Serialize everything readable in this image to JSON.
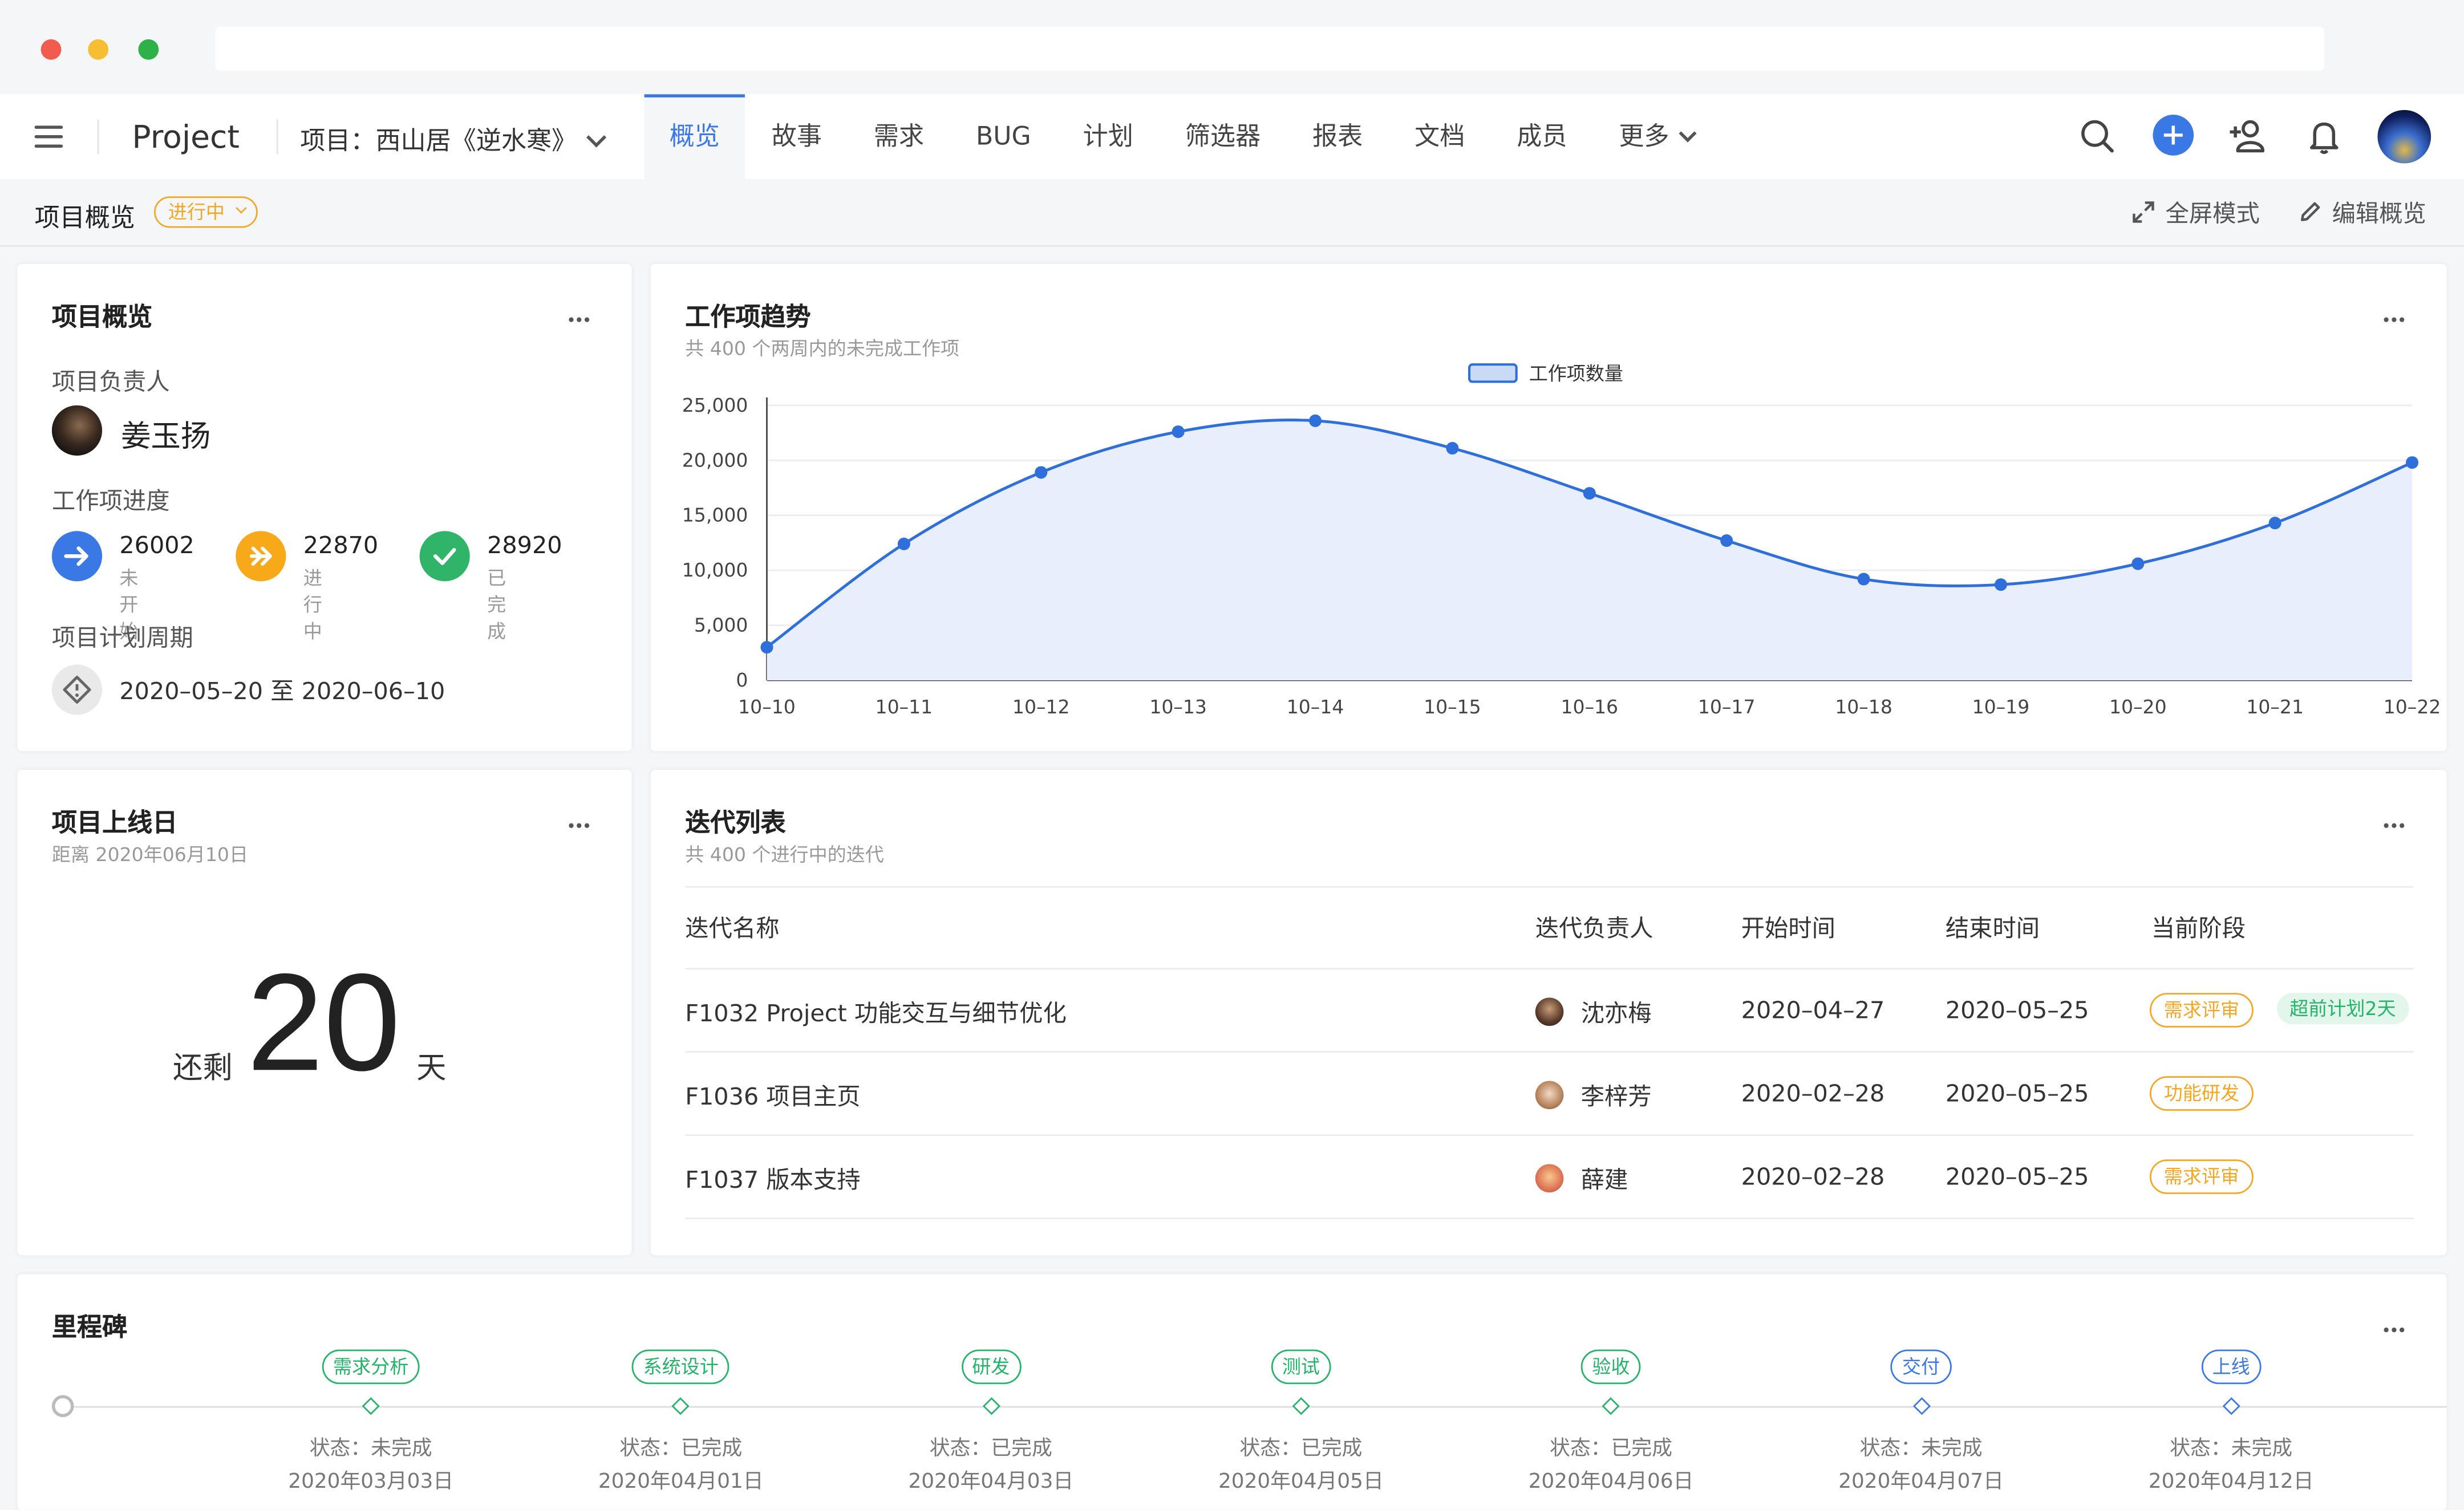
{
  "header": {
    "brand": "Project",
    "project_select": "项目：西山居《逆水寒》",
    "tabs": [
      "概览",
      "故事",
      "需求",
      "BUG",
      "计划",
      "筛选器",
      "报表",
      "文档",
      "成员",
      "更多"
    ]
  },
  "subheader": {
    "title": "项目概览",
    "status": "进行中",
    "fullscreen": "全屏模式",
    "edit": "编辑概览"
  },
  "overview": {
    "title": "项目概览",
    "owner_label": "项目负责人",
    "owner_name": "姜玉扬",
    "progress_label": "工作项进度",
    "progress": [
      {
        "value": "26002",
        "label": "未开始",
        "color": "#3a78e6"
      },
      {
        "value": "22870",
        "label": "进行中",
        "color": "#f7a91a"
      },
      {
        "value": "28920",
        "label": "已完成",
        "color": "#2fb46a"
      }
    ],
    "period_label": "项目计划周期",
    "period": "2020–05–20 至 2020–06–10"
  },
  "trend": {
    "title": "工作项趋势",
    "subtitle": "共 400 个两周内的未完成工作项"
  },
  "chart_data": {
    "type": "area",
    "title": "工作项趋势",
    "legend": "工作项数量",
    "legend_position": "top-center",
    "x": [
      "10–10",
      "10–11",
      "10–12",
      "10–13",
      "10–14",
      "10–15",
      "10–16",
      "10–17",
      "10–18",
      "10–19",
      "10–20",
      "10–21",
      "10–22"
    ],
    "series": [
      {
        "name": "工作项数量",
        "values": [
          3000,
          12400,
          18900,
          22600,
          23600,
          21100,
          17000,
          12700,
          9200,
          8700,
          10600,
          14300,
          19800
        ]
      }
    ],
    "y_ticks": [
      "25,000",
      "20,000",
      "15,000",
      "10,000",
      "5,000",
      "0"
    ],
    "ylim": [
      0,
      25000
    ],
    "grid": true,
    "color": "#2e6fdc"
  },
  "launch": {
    "title": "项目上线日",
    "subtitle": "距离 2020年06月10日",
    "prefix": "还剩",
    "days": "20",
    "suffix": "天"
  },
  "iterations": {
    "title": "迭代列表",
    "subtitle": "共 400 个进行中的迭代",
    "columns": [
      "迭代名称",
      "迭代负责人",
      "开始时间",
      "结束时间",
      "当前阶段"
    ],
    "rows": [
      {
        "name": "F1032 Project 功能交互与细节优化",
        "owner": "沈亦梅",
        "start": "2020–04–27",
        "end": "2020–05–25",
        "stage": "需求评审",
        "extra": "超前计划2天"
      },
      {
        "name": "F1036 项目主页",
        "owner": "李梓芳",
        "start": "2020–02–28",
        "end": "2020–05–25",
        "stage": "功能研发",
        "extra": ""
      },
      {
        "name": "F1037 版本支持",
        "owner": "薛建",
        "start": "2020–02–28",
        "end": "2020–05–25",
        "stage": "需求评审",
        "extra": ""
      }
    ]
  },
  "milestones": {
    "title": "里程碑",
    "items": [
      {
        "label": "需求分析",
        "status": "状态：未完成",
        "date": "2020年03月03日",
        "color": "#25b36a"
      },
      {
        "label": "系统设计",
        "status": "状态：已完成",
        "date": "2020年04月01日",
        "color": "#25b36a"
      },
      {
        "label": "研发",
        "status": "状态：已完成",
        "date": "2020年04月03日",
        "color": "#25b36a"
      },
      {
        "label": "测试",
        "status": "状态：已完成",
        "date": "2020年04月05日",
        "color": "#25b36a"
      },
      {
        "label": "验收",
        "status": "状态：已完成",
        "date": "2020年04月06日",
        "color": "#25b36a"
      },
      {
        "label": "交付",
        "status": "状态：未完成",
        "date": "2020年04月07日",
        "color": "#3a78e6"
      },
      {
        "label": "上线",
        "status": "状态：未完成",
        "date": "2020年04月12日",
        "color": "#3a78e6"
      }
    ]
  }
}
